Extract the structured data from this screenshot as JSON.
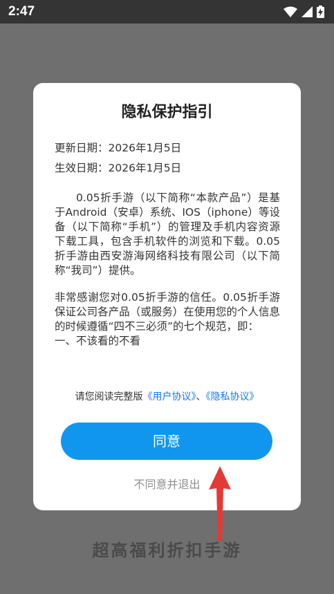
{
  "status_bar": {
    "time": "2:47",
    "icons": [
      "wifi-icon",
      "signal-icon",
      "battery-charging-icon"
    ]
  },
  "dialog": {
    "title": "隐私保护指引",
    "update_date": "更新日期：2026年1月5日",
    "effective_date": "生效日期：2026年1月5日",
    "paragraph1": "0.05折手游（以下简称“本款产品”）是基于Android（安卓）系统、IOS（iphone）等设备（以下简称“手机”）的管理及手机内容资源下载工具，包含手机软件的浏览和下载。0.05折手游由西安游海网络科技有限公司（以下简称“我司”）提供。",
    "paragraph2": "非常感谢您对0.05折手游的信任。0.05折手游保证公司各产品（或服务）在使用您的个人信息的时候遵循“四不三必须”的七个规范，即：",
    "paragraph3": "一、不该看的不看",
    "links_prefix": "请您阅读完整版",
    "user_agreement": "《用户协议》",
    "links_separator": "、",
    "privacy_agreement": "《隐私协议》",
    "agree_label": "同意",
    "disagree_label": "不同意并退出"
  },
  "background": {
    "promo_text": "超高福利折扣手游"
  },
  "colors": {
    "accent": "#1196f0",
    "link": "#1677ff",
    "overlay": "#6f6f6f",
    "arrow": "#e53935"
  }
}
